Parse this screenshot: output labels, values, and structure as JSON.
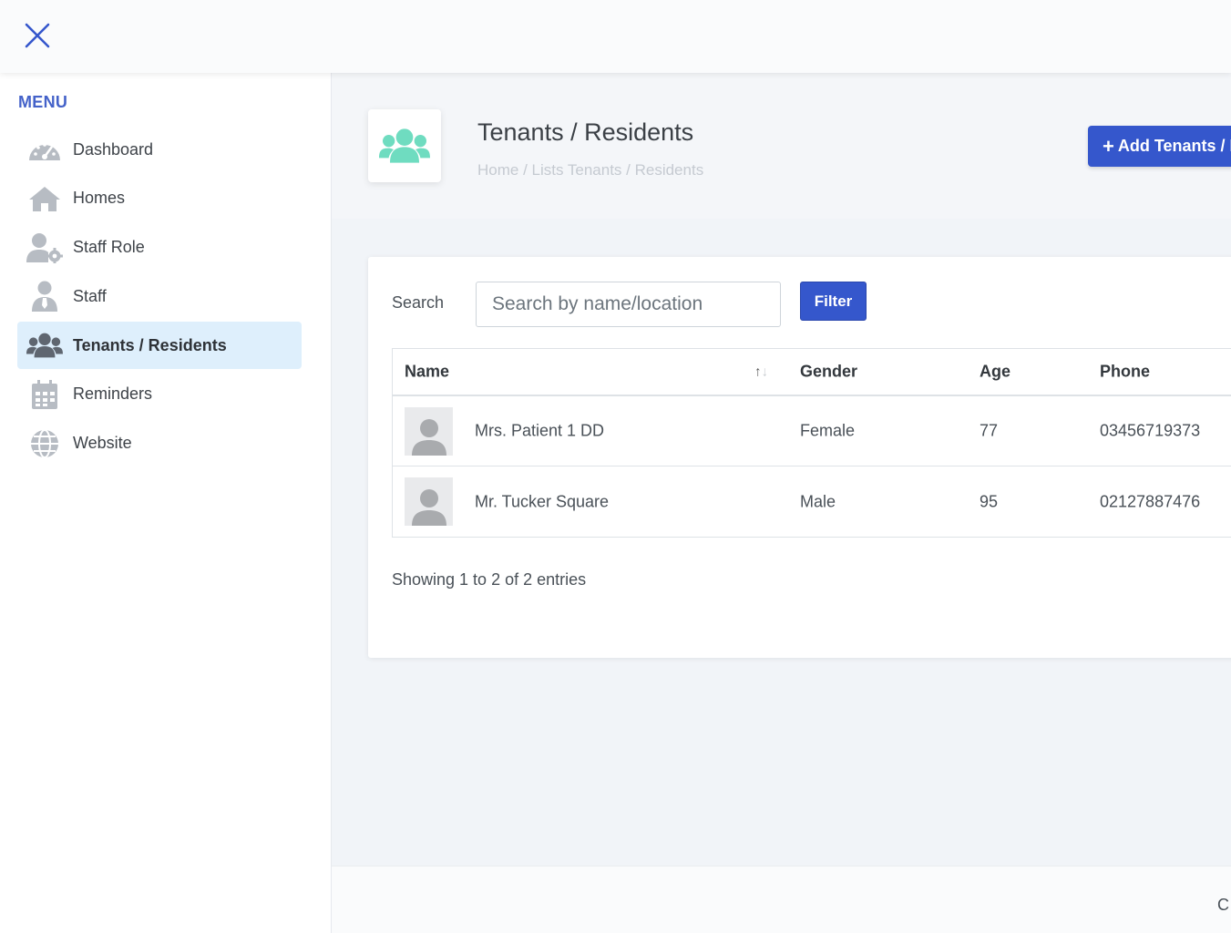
{
  "topbar": {
    "close_icon": "close-icon"
  },
  "sidebar": {
    "menu_title": "MENU",
    "items": [
      {
        "label": "Dashboard",
        "icon": "dashboard-gauge-icon",
        "active": false
      },
      {
        "label": "Homes",
        "icon": "home-icon",
        "active": false
      },
      {
        "label": "Staff Role",
        "icon": "user-gear-icon",
        "active": false
      },
      {
        "label": "Staff",
        "icon": "user-tie-icon",
        "active": false
      },
      {
        "label": "Tenants / Residents",
        "icon": "users-icon",
        "active": true
      },
      {
        "label": "Reminders",
        "icon": "calendar-icon",
        "active": false
      },
      {
        "label": "Website",
        "icon": "globe-icon",
        "active": false
      }
    ]
  },
  "header": {
    "title": "Tenants / Residents",
    "breadcrumb": "Home / Lists Tenants / Residents",
    "add_button": "Add Tenants / R",
    "icon": "users-icon"
  },
  "search": {
    "label": "Search",
    "placeholder": "Search by name/location",
    "filter_button": "Filter"
  },
  "table": {
    "headers": {
      "name": "Name",
      "gender": "Gender",
      "age": "Age",
      "phone": "Phone"
    },
    "rows": [
      {
        "name": "Mrs. Patient 1 DD",
        "gender": "Female",
        "age": "77",
        "phone": "03456719373"
      },
      {
        "name": "Mr. Tucker Square",
        "gender": "Male",
        "age": "95",
        "phone": "02127887476"
      }
    ]
  },
  "showing": "Showing 1 to 2 of 2 entries",
  "footer": {
    "text": "C"
  },
  "colors": {
    "primary": "#3557cc",
    "menu_title": "#4462c9",
    "active_bg": "#deeffc",
    "header_icon": "#6fdcc0",
    "sidebar_icon": "#b7bcc3"
  }
}
